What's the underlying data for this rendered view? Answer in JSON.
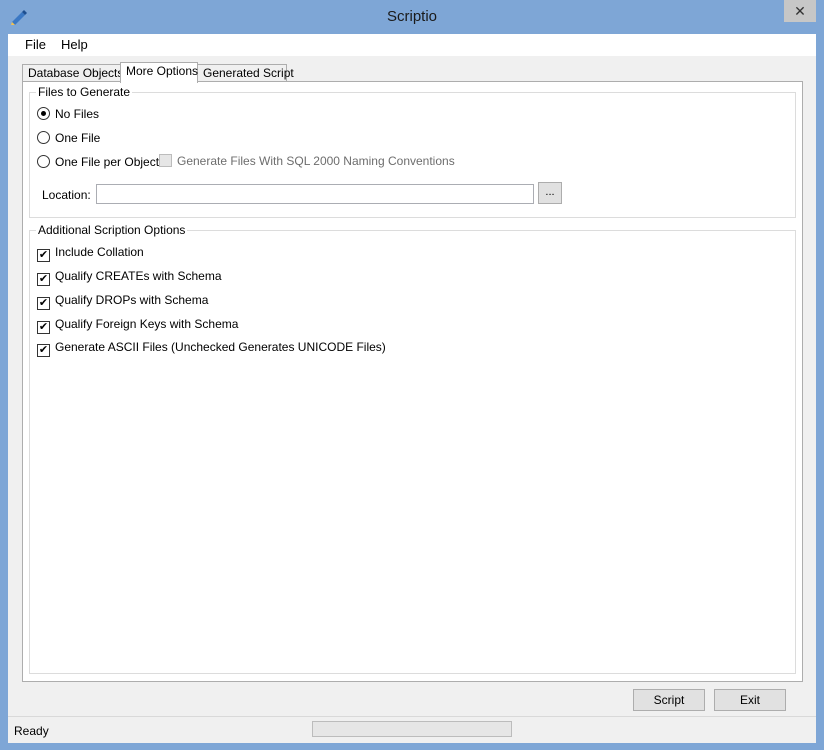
{
  "window": {
    "title": "Scriptio",
    "close_glyph": "✕"
  },
  "menu": {
    "file": "File",
    "help": "Help"
  },
  "tabs": [
    {
      "label": "Database Objects",
      "active": false
    },
    {
      "label": "More Options",
      "active": true
    },
    {
      "label": "Generated Script",
      "active": false
    }
  ],
  "files_group": {
    "title": "Files to Generate",
    "options": [
      {
        "label": "No Files",
        "selected": true
      },
      {
        "label": "One File",
        "selected": false
      },
      {
        "label": "One File per Object",
        "selected": false
      }
    ],
    "sql2000": {
      "label": "Generate Files With SQL 2000 Naming Conventions",
      "checked": false,
      "enabled": false
    },
    "location": {
      "label": "Location:",
      "value": "",
      "browse": "..."
    }
  },
  "additional_group": {
    "title": "Additional Scription Options",
    "options": [
      {
        "label": "Include Collation",
        "checked": true
      },
      {
        "label": "Qualify CREATEs with Schema",
        "checked": true
      },
      {
        "label": "Qualify DROPs with Schema",
        "checked": true
      },
      {
        "label": "Qualify Foreign Keys with Schema",
        "checked": true
      },
      {
        "label": "Generate ASCII Files (Unchecked Generates UNICODE Files)",
        "checked": true
      }
    ]
  },
  "buttons": {
    "script": "Script",
    "exit": "Exit"
  },
  "status": {
    "text": "Ready",
    "progress": 0
  },
  "check_glyph": "✔"
}
